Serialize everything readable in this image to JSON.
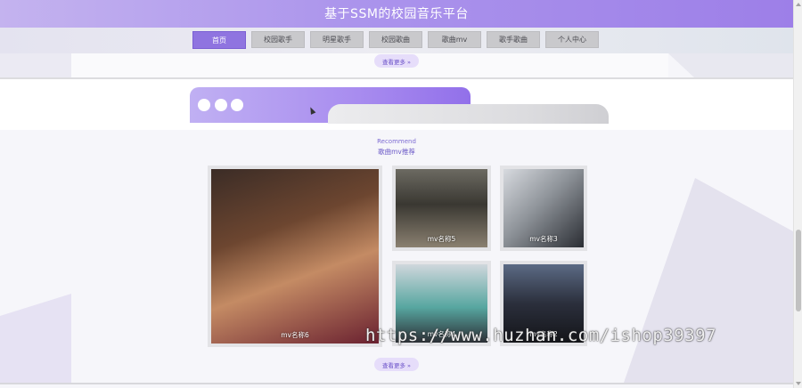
{
  "header": {
    "title": "基于SSM的校园音乐平台"
  },
  "nav": {
    "items": [
      {
        "label": "首页",
        "active": true
      },
      {
        "label": "校园歌手",
        "active": false
      },
      {
        "label": "明星歌手",
        "active": false
      },
      {
        "label": "校园歌曲",
        "active": false
      },
      {
        "label": "歌曲mv",
        "active": false
      },
      {
        "label": "歌手歌曲",
        "active": false
      },
      {
        "label": "个人中心",
        "active": false
      }
    ]
  },
  "previous_section": {
    "more_label": "查看更多 »"
  },
  "banner": {
    "icons": [
      "dot-icon",
      "dot-icon",
      "dot-icon"
    ]
  },
  "recommend": {
    "subtitle_en": "Recommend",
    "title": "歌曲mv推荐",
    "cards": [
      {
        "caption": "mv名称6"
      },
      {
        "caption": "mv名称5"
      },
      {
        "caption": "mv名称3"
      },
      {
        "caption": "mv名称4"
      },
      {
        "caption": "mv名称2"
      }
    ],
    "more_label": "查看更多 »"
  },
  "watermark": {
    "text": "https://www.huzhan.com/ishop39397"
  },
  "colors": {
    "accent": "#9d7fe8",
    "nav_active": "#8f74e0",
    "nav_inactive": "#c9c9cc"
  }
}
